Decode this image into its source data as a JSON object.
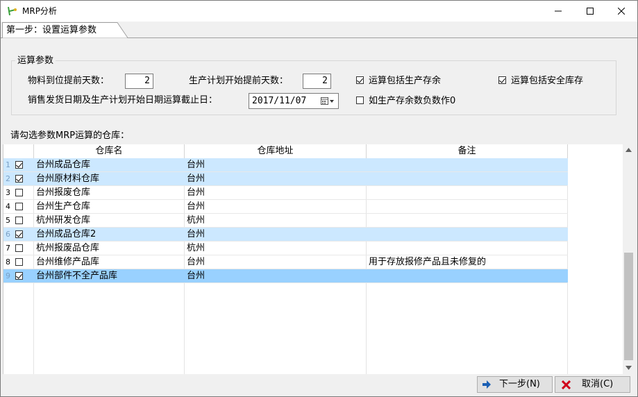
{
  "window": {
    "title": "MRP分析"
  },
  "tab": {
    "label": "第一步：设置运算参数"
  },
  "params": {
    "group_title": "运算参数",
    "lead_days_label": "物料到位提前天数：",
    "lead_days_value": "2",
    "plan_start_label": "生产计划开始提前天数：",
    "plan_start_value": "2",
    "include_stock_label": "运算包括生产存余",
    "include_stock_checked": true,
    "include_safety_label": "运算包括安全库存",
    "include_safety_checked": true,
    "cutoff_label": "销售发货日期及生产计划开始日期运算截止日：",
    "cutoff_value": "2017/11/07",
    "negative_zero_label": "如生产存余数负数作0",
    "negative_zero_checked": false
  },
  "warehouse_list": {
    "caption": "请勾选参数MRP运算的仓库：",
    "columns": [
      "仓库名",
      "仓库地址",
      "备注"
    ],
    "rows": [
      {
        "num": "1",
        "checked": true,
        "name": "台州成品仓库",
        "address": "台州",
        "note": ""
      },
      {
        "num": "2",
        "checked": true,
        "name": "台州原材料仓库",
        "address": "台州",
        "note": ""
      },
      {
        "num": "3",
        "checked": false,
        "name": "台州报废仓库",
        "address": "台州",
        "note": ""
      },
      {
        "num": "4",
        "checked": false,
        "name": "台州生产仓库",
        "address": "台州",
        "note": ""
      },
      {
        "num": "5",
        "checked": false,
        "name": "杭州研发仓库",
        "address": "杭州",
        "note": ""
      },
      {
        "num": "6",
        "checked": true,
        "name": "台州成品仓库2",
        "address": "台州",
        "note": ""
      },
      {
        "num": "7",
        "checked": false,
        "name": "杭州报废品仓库",
        "address": "杭州",
        "note": ""
      },
      {
        "num": "8",
        "checked": false,
        "name": "台州维修产品库",
        "address": "台州",
        "note": "用于存放报修产品且未修复的"
      },
      {
        "num": "9",
        "checked": true,
        "name": "台州部件不全产品库",
        "address": "台州",
        "note": ""
      }
    ]
  },
  "footer": {
    "next_label": "下一步(N)",
    "cancel_label": "取消(C)"
  },
  "colors": {
    "row_checked": "#cce8ff",
    "row_selected": "#99d1ff"
  }
}
